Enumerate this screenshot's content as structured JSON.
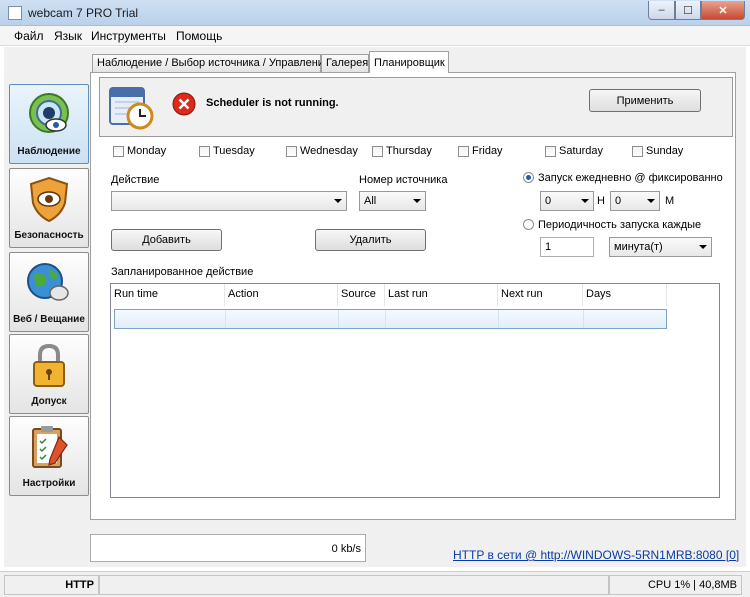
{
  "window": {
    "title": "webcam 7 PRO Trial",
    "min_glyph": "–",
    "max_glyph": "☐",
    "close_glyph": "✕"
  },
  "menu": [
    "Файл",
    "Язык",
    "Инструменты",
    "Помощь"
  ],
  "sidebar": [
    {
      "label": "Наблюдение",
      "icon": "eye-webcam-icon",
      "active": true
    },
    {
      "label": "Безопасность",
      "icon": "shield-icon",
      "active": false
    },
    {
      "label": "Веб / Вещание",
      "icon": "globe-icon",
      "active": false
    },
    {
      "label": "Допуск",
      "icon": "padlock-icon",
      "active": false
    },
    {
      "label": "Настройки",
      "icon": "clipboard-pencil-icon",
      "active": false
    }
  ],
  "tabs": [
    {
      "label": "Наблюдение / Выбор источника / Управление",
      "active": false
    },
    {
      "label": "Галерея",
      "active": false
    },
    {
      "label": "Планировщик",
      "active": true
    }
  ],
  "scheduler": {
    "status_text": "Scheduler is not running.",
    "apply_label": "Применить",
    "days": [
      "Monday",
      "Tuesday",
      "Wednesday",
      "Thursday",
      "Friday",
      "Saturday",
      "Sunday"
    ],
    "action_label": "Действие",
    "action_value": "",
    "source_label": "Номер источника",
    "source_value": "All",
    "daily_label": "Запуск ежедневно @ фиксированно",
    "hour_value": "0",
    "hour_unit": "H",
    "minute_value": "0",
    "minute_unit": "M",
    "periodic_label": "Периодичность запуска каждые",
    "period_value": "1",
    "period_unit": "минута(т)",
    "add_label": "Добавить",
    "delete_label": "Удалить",
    "list_title": "Запланированное действие",
    "columns": [
      "Run time",
      "Action",
      "Source",
      "Last run",
      "Next run",
      "Days"
    ]
  },
  "footer": {
    "speed": "0 kb/s",
    "http_link": "HTTP в сети @ http://WINDOWS-5RN1MRB:8080 [0]"
  },
  "statusbar": {
    "protocol": "HTTP",
    "cpu": "CPU 1% | 40,8MB"
  },
  "colors": {
    "accent": "#2c5aa0",
    "error": "#d92a1c",
    "link": "#0a3aa6"
  }
}
